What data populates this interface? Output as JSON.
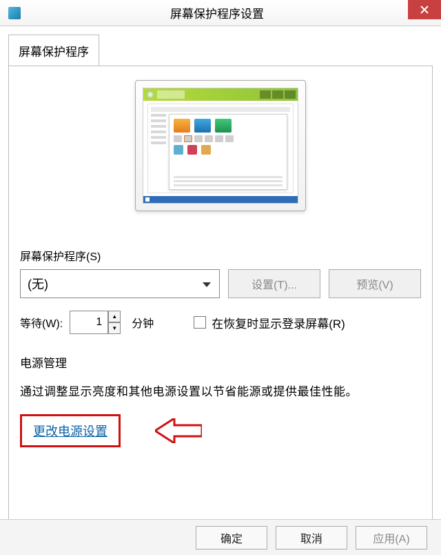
{
  "titlebar": {
    "title": "屏幕保护程序设置"
  },
  "tab": {
    "label": "屏幕保护程序"
  },
  "screensaver_section": {
    "heading": "屏幕保护程序(S)",
    "selected": "(无)",
    "settings_btn": "设置(T)...",
    "preview_btn": "预览(V)"
  },
  "wait": {
    "label": "等待(W):",
    "value": "1",
    "unit": "分钟",
    "resume_checkbox": "在恢复时显示登录屏幕(R)"
  },
  "power": {
    "heading": "电源管理",
    "description": "通过调整显示亮度和其他电源设置以节省能源或提供最佳性能。",
    "link": "更改电源设置"
  },
  "footer": {
    "ok": "确定",
    "cancel": "取消",
    "apply": "应用(A)"
  }
}
